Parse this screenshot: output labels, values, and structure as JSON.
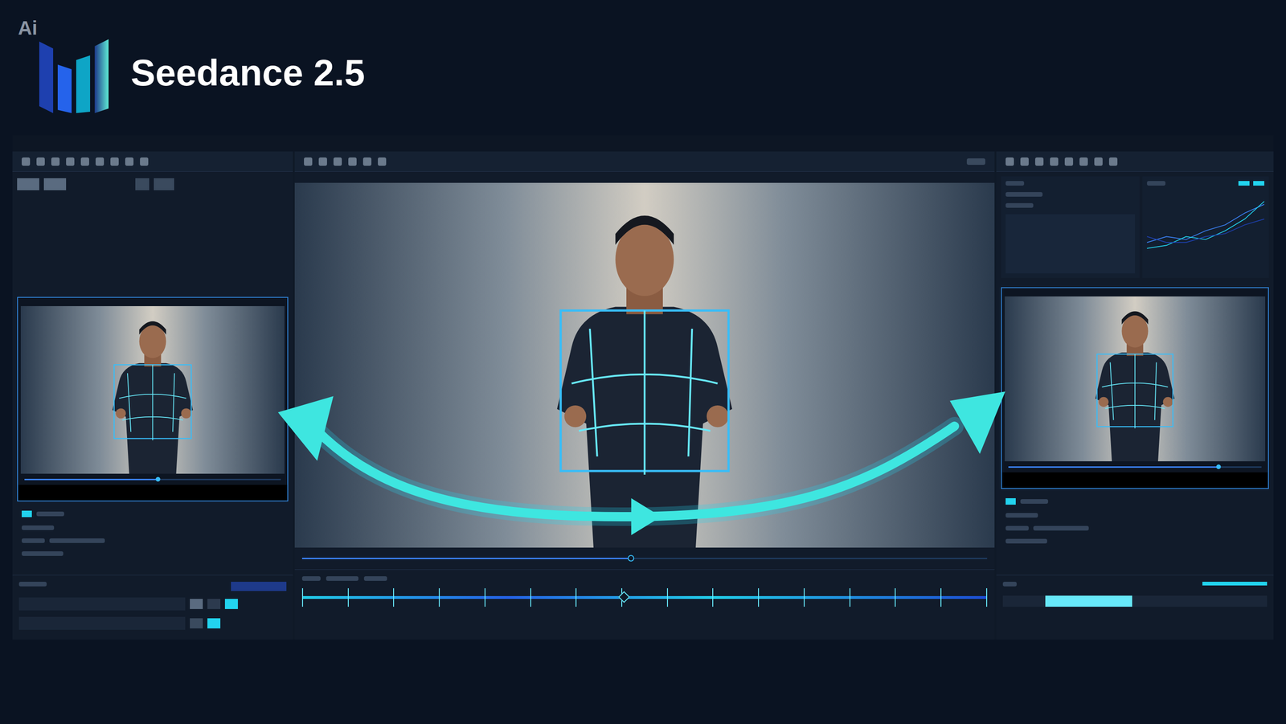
{
  "brand": {
    "badge": "Ai",
    "title": "Seedance 2.5"
  },
  "left_preview": {
    "scrub_level": 0.52
  },
  "main_viewer": {
    "scrub_level": 0.48,
    "timeline_playhead": 0.47
  },
  "right_preview": {
    "scrub_level": 0.83
  },
  "right_graph": {
    "series": [
      {
        "values": [
          2,
          3,
          2.5,
          4,
          5,
          7,
          8.5
        ],
        "color": "#3b82f6"
      },
      {
        "values": [
          1,
          1.5,
          3,
          2.5,
          4,
          6,
          9
        ],
        "color": "#22d3ee"
      },
      {
        "values": [
          3,
          2,
          2,
          3,
          3.5,
          5,
          6
        ],
        "color": "#1e40af"
      }
    ]
  },
  "right_clip": {
    "start": 0.16,
    "level": 0.33
  }
}
